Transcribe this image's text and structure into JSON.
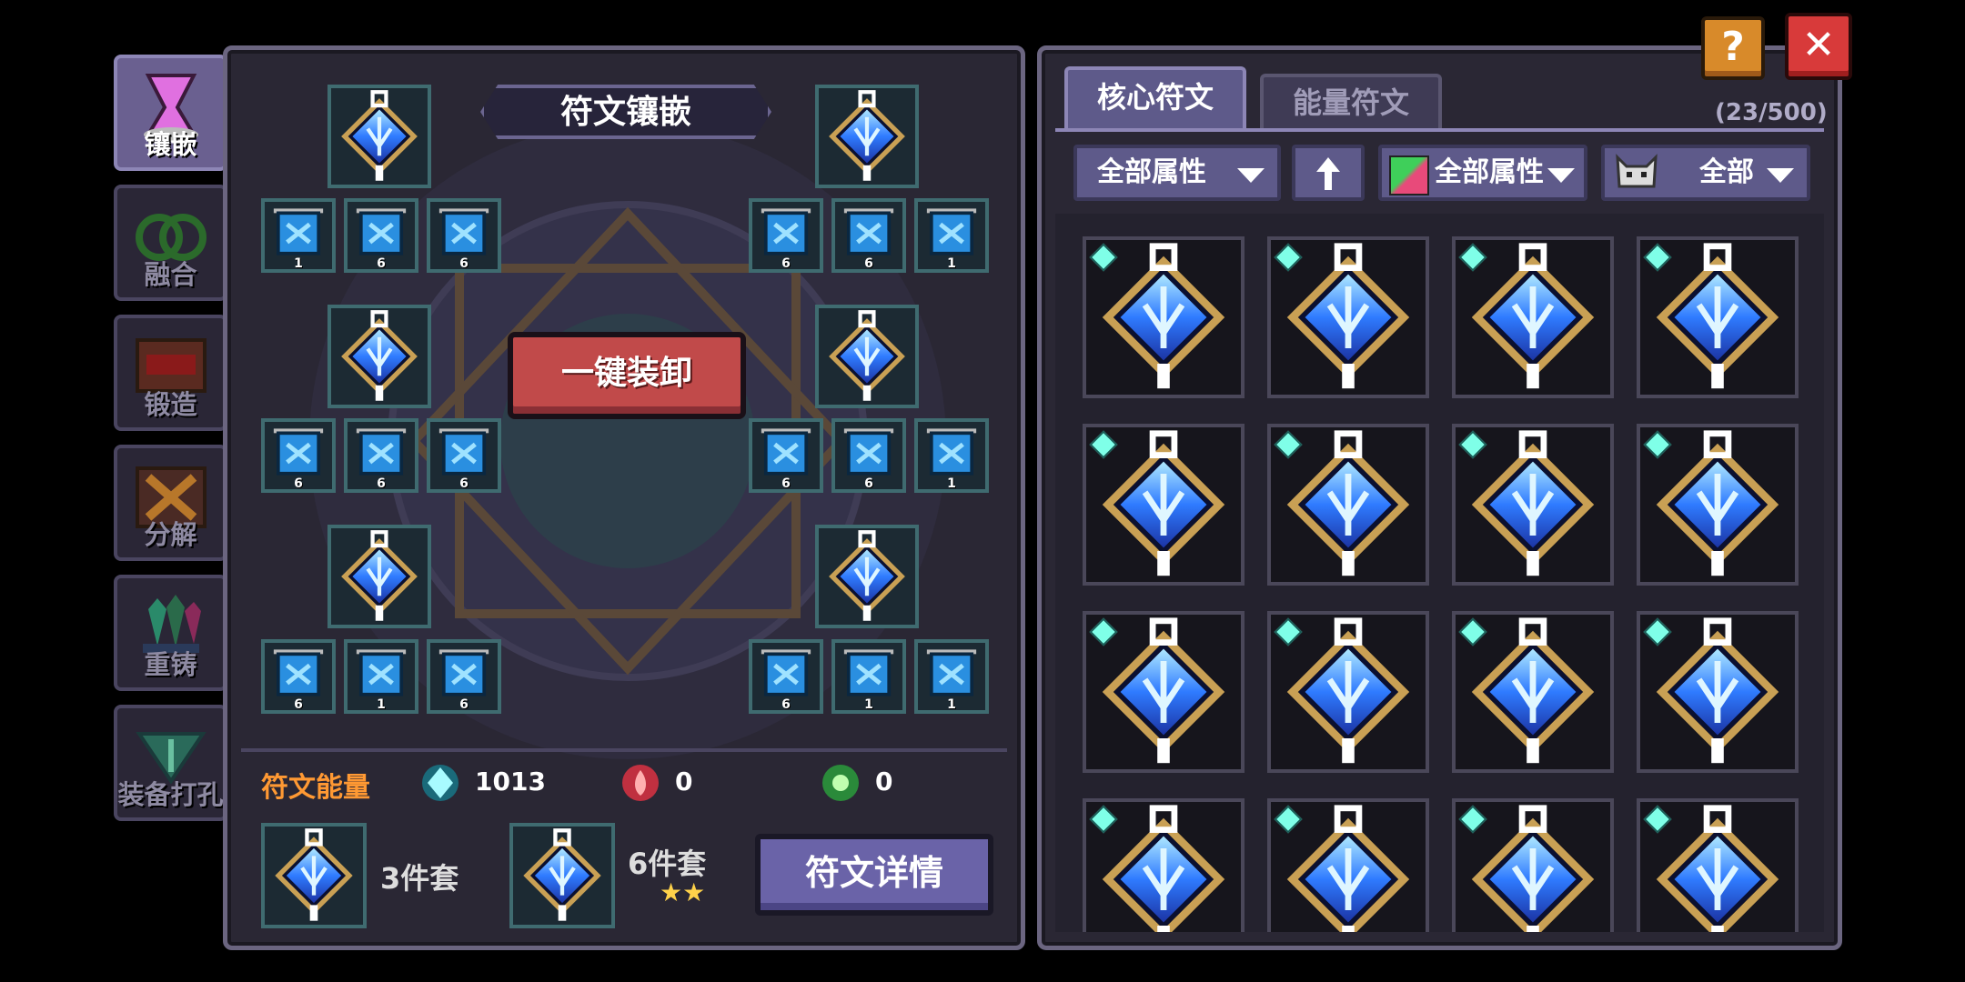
{
  "side_tabs": [
    {
      "label": "镶嵌",
      "icon": "goblet-icon",
      "active": true
    },
    {
      "label": "融合",
      "icon": "rings-icon",
      "active": false
    },
    {
      "label": "锻造",
      "icon": "anvil-icon",
      "active": false
    },
    {
      "label": "分解",
      "icon": "explosion-icon",
      "active": false
    },
    {
      "label": "重铸",
      "icon": "crystals-icon",
      "active": false
    },
    {
      "label": "装备打孔",
      "icon": "drill-icon",
      "active": false
    }
  ],
  "inlay": {
    "title": "符文镶嵌",
    "unequip_all_label": "一键装卸",
    "small_slot_levels": {
      "row1_left": [
        "1",
        "6",
        "6"
      ],
      "row1_right": [
        "6",
        "6",
        "1"
      ],
      "row2_left": [
        "6",
        "6",
        "6"
      ],
      "row2_right": [
        "6",
        "6",
        "1"
      ],
      "row3_left": [
        "6",
        "1",
        "6"
      ],
      "row3_right": [
        "6",
        "1",
        "1"
      ]
    }
  },
  "energy": {
    "label": "符文能量",
    "items": [
      {
        "icon": "cyan-gem-icon",
        "value": "1013"
      },
      {
        "icon": "red-gem-icon",
        "value": "0"
      },
      {
        "icon": "green-gem-icon",
        "value": "0"
      }
    ]
  },
  "sets": [
    {
      "label": "3件套",
      "stars": ""
    },
    {
      "label": "6件套",
      "stars": "★★"
    }
  ],
  "details_button": "符文详情",
  "inventory": {
    "tabs": [
      "核心符文",
      "能量符文"
    ],
    "count": "(23/500)",
    "filters": {
      "attribute1": "全部属性",
      "attribute2": "全部属性",
      "type": "全部"
    },
    "rune_count": 16
  },
  "top_buttons": {
    "help": "?",
    "close": "✕"
  },
  "colors": {
    "bg": "#000000",
    "panel": "#2a2734",
    "panel_border": "#6b6580",
    "accent_red": "#c14a4a",
    "accent_purple": "#5e5a8a",
    "energy_label": "#ff9933",
    "rune_blue": "#3a7bff"
  }
}
